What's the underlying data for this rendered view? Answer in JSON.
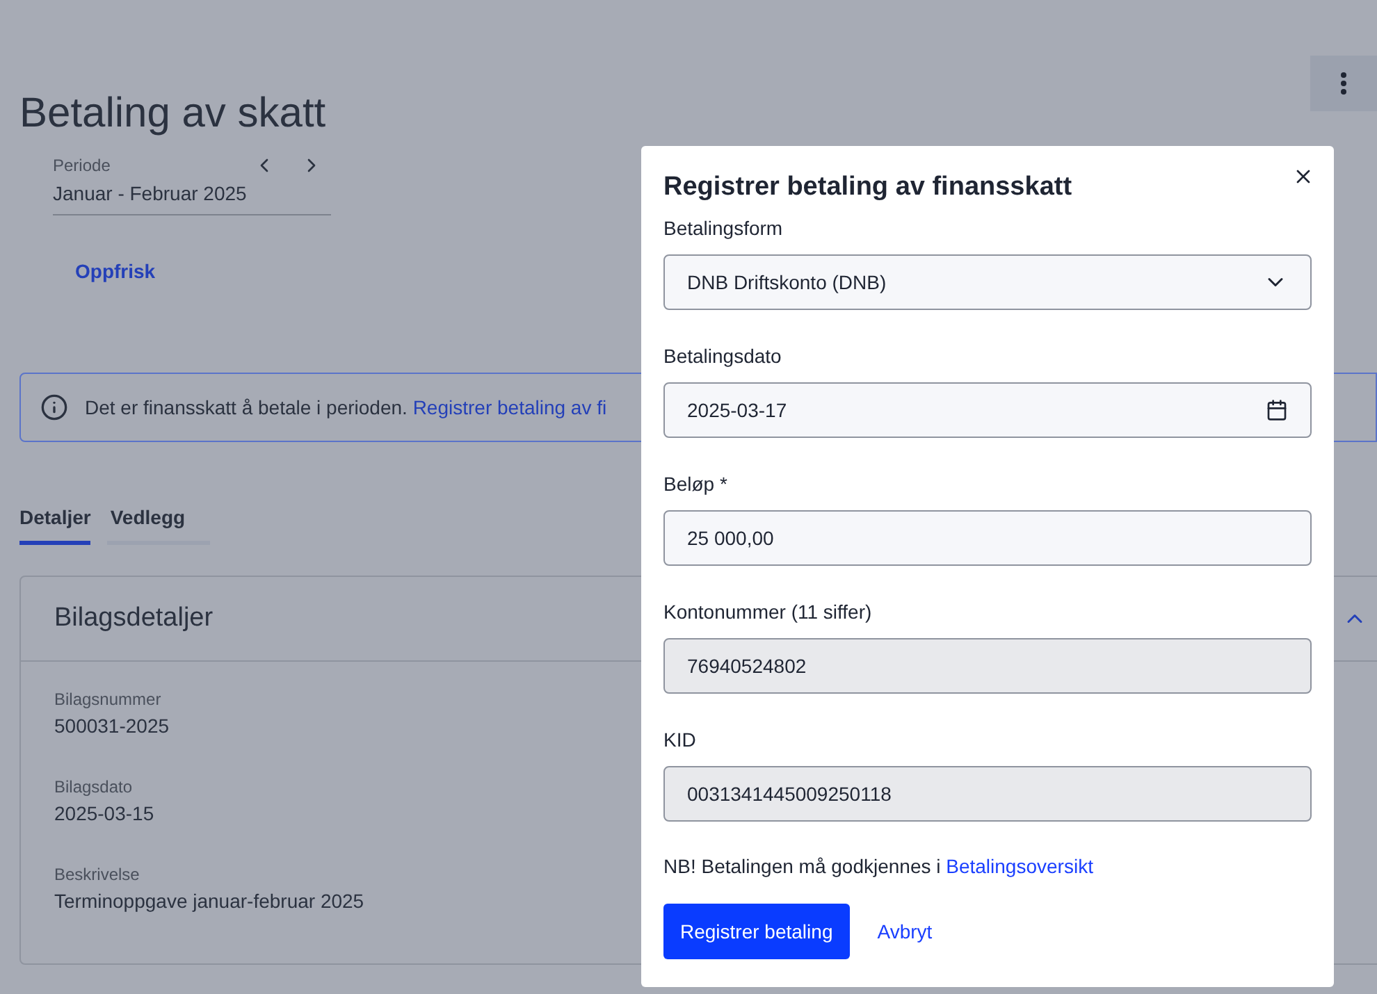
{
  "page": {
    "title": "Betaling av skatt",
    "period": {
      "label": "Periode",
      "value": "Januar - Februar 2025"
    },
    "refresh": "Oppfrisk",
    "info": {
      "text": "Det er finansskatt å betale i perioden.",
      "link": "Registrer betaling av fi"
    },
    "tabs": [
      {
        "label": "Detaljer",
        "selected": true
      },
      {
        "label": "Vedlegg",
        "selected": false
      }
    ],
    "card": {
      "title": "Bilagsdetaljer",
      "expanded": true,
      "fields": [
        {
          "label": "Bilagsnummer",
          "value": "500031-2025"
        },
        {
          "label": "Bilagsdato",
          "value": "2025-03-15"
        },
        {
          "label": "Beskrivelse",
          "value": "Terminoppgave januar-februar 2025"
        }
      ]
    }
  },
  "dialog": {
    "title": "Registrer betaling av finansskatt",
    "fields": [
      {
        "kind": "select",
        "label": "Betalingsform",
        "value": "DNB Driftskonto (DNB)",
        "disabled": false
      },
      {
        "kind": "date",
        "label": "Betalingsdato",
        "value": "2025-03-17",
        "disabled": false
      },
      {
        "kind": "text",
        "label": "Beløp *",
        "value": "25 000,00",
        "disabled": false
      },
      {
        "kind": "text",
        "label": "Kontonummer (11 siffer)",
        "value": "76940524802",
        "disabled": true
      },
      {
        "kind": "text",
        "label": "KID",
        "value": "0031341445009250118",
        "disabled": true
      }
    ],
    "note": {
      "text": "NB! Betalingen må godkjennes i",
      "link": "Betalingsoversikt"
    },
    "submit": "Registrer betaling",
    "cancel": "Avbryt"
  }
}
